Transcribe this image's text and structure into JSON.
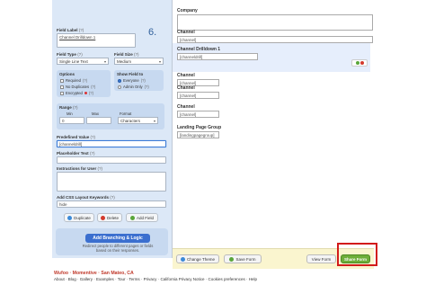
{
  "left": {
    "step_number": "6.",
    "field_label": {
      "label": "Field Label",
      "help": "(?)",
      "value": "Channel Drilldown 1"
    },
    "field_type": {
      "label": "Field Type",
      "help": "(?)",
      "value": "Single Line Text"
    },
    "field_size": {
      "label": "Field Size",
      "help": "(?)",
      "value": "Medium"
    },
    "options": {
      "title": "Options",
      "items": [
        {
          "label": "Required",
          "help": "(?)",
          "checked": false
        },
        {
          "label": "No Duplicates",
          "help": "(?)",
          "checked": false
        },
        {
          "label": "Encrypted",
          "help": "(?)",
          "checked": false
        }
      ]
    },
    "show_field": {
      "title": "Show Field to",
      "items": [
        {
          "label": "Everyone",
          "help": "(?)",
          "selected": true
        },
        {
          "label": "Admin Only",
          "help": "(?)",
          "selected": false
        }
      ]
    },
    "range": {
      "title": "Range",
      "help": "(?)",
      "min_label": "Min",
      "max_label": "Max",
      "format_label": "Format",
      "min_value": "0",
      "max_value": "",
      "format_value": "Characters"
    },
    "predefined_value": {
      "label": "Predefined Value",
      "help": "(?)",
      "value": "[channeldrill]"
    },
    "placeholder_text": {
      "label": "Placeholder Text",
      "help": "(?)",
      "value": ""
    },
    "instructions": {
      "label": "Instructions for User",
      "help": "(?)",
      "value": ""
    },
    "css_keywords": {
      "label": "Add CSS Layout Keywords",
      "help": "(?)",
      "value": "hide"
    },
    "buttons": {
      "duplicate": "Duplicate",
      "delete": "Delete",
      "add_field": "Add Field"
    },
    "branching": {
      "button": "Add Branching & Logic",
      "note": "Redirect people to different pages or fields based on their responses."
    }
  },
  "form": {
    "fields": [
      {
        "label": "Company",
        "value": ""
      },
      {
        "label": "Channel",
        "value": "[channel]"
      },
      {
        "label": "Channel Drilldown 1",
        "value": "[channeldrill]"
      },
      {
        "label": "Channel",
        "value": "[channel]"
      },
      {
        "label": "Channel",
        "value": "[channel]"
      },
      {
        "label": "Channel",
        "value": "[channel]"
      },
      {
        "label": "Landing Page Group",
        "value": "[landingpagegroup]"
      }
    ]
  },
  "footer": {
    "change_theme": "Change Theme",
    "save_form": "Save Form",
    "view_form": "View Form",
    "share_form": "Share Form"
  },
  "site": {
    "brand_wufoo": "Wufoo",
    "brand_rest": "· Momentive · San Mateo, CA",
    "links": [
      "About",
      "Blog",
      "Gallery",
      "Examples",
      "Tour",
      "Terms",
      "Privacy",
      "California Privacy Notice",
      "Cookies preferences",
      "Help"
    ]
  },
  "colors": {
    "accent_blue": "#3b6fcf",
    "share_green": "#6dae3a",
    "highlight_red": "#d21b1b",
    "panel_blue": "#dce8f7"
  }
}
